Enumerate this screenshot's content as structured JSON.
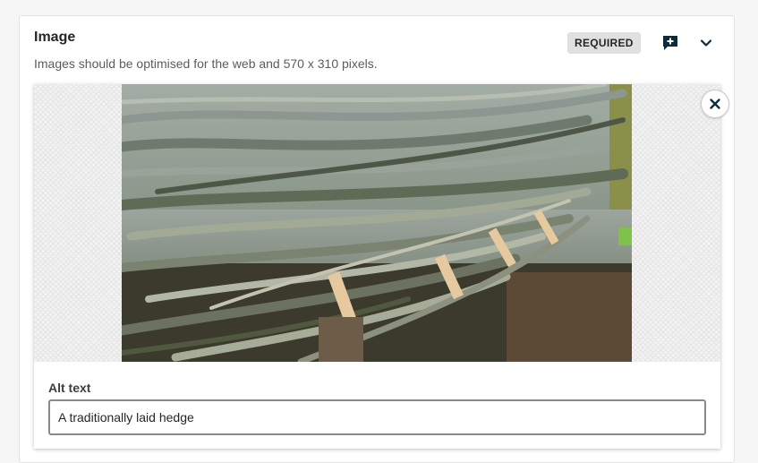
{
  "field": {
    "title": "Image",
    "help_text": "Images should be optimised for the web and 570 x 310 pixels.",
    "required_badge": "REQUIRED"
  },
  "icons": {
    "comment": "comment-add-icon",
    "collapse": "chevron-down-icon",
    "remove": "close-icon"
  },
  "image_preview": {
    "subject": "hedge-photo"
  },
  "alt_text": {
    "label": "Alt text",
    "value": "A traditionally laid hedge"
  },
  "colors": {
    "accent": "#0c2c3c",
    "badge_bg": "#e0e0e0"
  }
}
